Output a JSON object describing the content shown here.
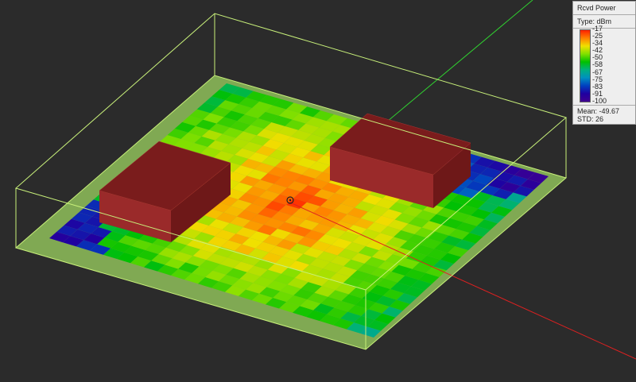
{
  "legend": {
    "title": "Rcvd Power",
    "type_label": "Type: dBm",
    "ticks": [
      "-17",
      "-25",
      "-34",
      "-42",
      "-50",
      "-58",
      "-67",
      "-75",
      "-83",
      "-91",
      "-100"
    ],
    "mean_label": "Mean:",
    "mean": "-49.67",
    "std_label": "STD:",
    "std": "26"
  },
  "scale": {
    "min": -100,
    "max": -17
  },
  "colors": {
    "background": "#2b2b2b",
    "floor": "#8fbf5a",
    "building": "#8b2020",
    "wireframe": "#c8f07a",
    "axis_y": "#30d030",
    "axis_x": "#e02020"
  }
}
